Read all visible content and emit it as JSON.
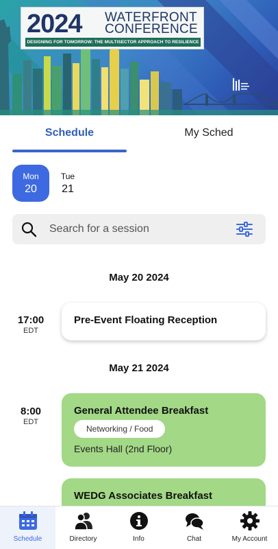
{
  "banner": {
    "year": "2024",
    "name_line1": "WATERFRONT",
    "name_line2": "CONFERENCE",
    "tagline": "DESIGNING FOR TOMORROW: THE MULTISECTOR APPROACH TO RESILIENCE"
  },
  "tabs": {
    "schedule": "Schedule",
    "my_sched": "My Sched"
  },
  "days": [
    {
      "name": "Mon",
      "num": "20",
      "selected": true
    },
    {
      "name": "Tue",
      "num": "21",
      "selected": false
    }
  ],
  "search": {
    "placeholder": "Search for a session"
  },
  "sections": [
    {
      "date": "May 20 2024",
      "sessions": [
        {
          "time": "17:00",
          "tz": "EDT",
          "title": "Pre-Event Floating Reception"
        }
      ]
    },
    {
      "date": "May 21 2024",
      "sessions": [
        {
          "time": "8:00",
          "tz": "EDT",
          "title": "General Attendee Breakfast",
          "tag": "Networking / Food",
          "location": "Events Hall (2nd Floor)"
        },
        {
          "title": "WEDG Associates Breakfast"
        }
      ]
    }
  ],
  "nav": [
    {
      "label": "Schedule",
      "icon": "calendar-icon",
      "active": true
    },
    {
      "label": "Directory",
      "icon": "people-icon",
      "active": false
    },
    {
      "label": "Info",
      "icon": "info-icon",
      "active": false
    },
    {
      "label": "Chat",
      "icon": "chat-icon",
      "active": false
    },
    {
      "label": "My Account",
      "icon": "gear-icon",
      "active": false
    }
  ],
  "colors": {
    "accent": "#3d6ae0",
    "card_green": "#a2d886",
    "banner_navy": "#1f3568",
    "banner_green": "#1f6e5a"
  }
}
